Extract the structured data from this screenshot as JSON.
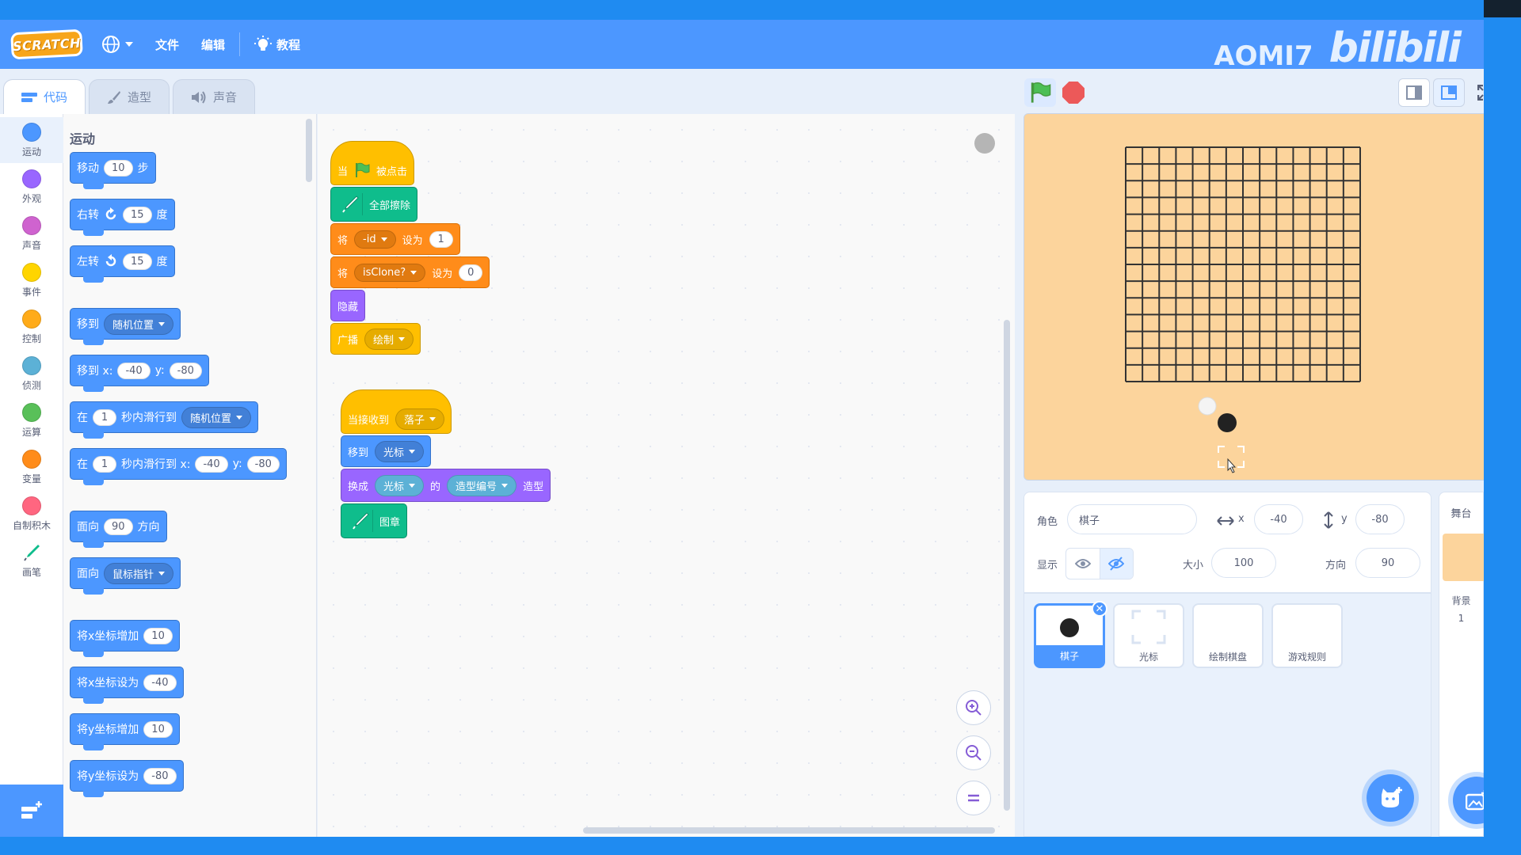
{
  "menubar": {
    "logo_text": "SCRATCH",
    "file": "文件",
    "edit": "编辑",
    "tutorials": "教程",
    "watermark_name": "AOMI7",
    "watermark_brand": "bilibili"
  },
  "tabs": {
    "code": "代码",
    "costumes": "造型",
    "sounds": "声音"
  },
  "categories": [
    {
      "label": "运动",
      "color": "#4c97ff"
    },
    {
      "label": "外观",
      "color": "#9966ff"
    },
    {
      "label": "声音",
      "color": "#cf63cf"
    },
    {
      "label": "事件",
      "color": "#ffd500"
    },
    {
      "label": "控制",
      "color": "#ffab19"
    },
    {
      "label": "侦测",
      "color": "#5cb1d6"
    },
    {
      "label": "运算",
      "color": "#59c059"
    },
    {
      "label": "变量",
      "color": "#ff8c1a"
    },
    {
      "label": "自制积木",
      "color": "#ff6680"
    },
    {
      "label": "画笔",
      "color": "#0fbd8c"
    }
  ],
  "palette": {
    "title": "运动",
    "move": {
      "label": "移动",
      "steps": "10",
      "unit": "步"
    },
    "turn_right": {
      "label": "右转",
      "deg": "15",
      "unit": "度"
    },
    "turn_left": {
      "label": "左转",
      "deg": "15",
      "unit": "度"
    },
    "goto": {
      "label": "移到",
      "target": "随机位置"
    },
    "goto_xy": {
      "label": "移到 x:",
      "x": "-40",
      "ylabel": "y:",
      "y": "-80"
    },
    "glide": {
      "pre": "在",
      "secs": "1",
      "mid": "秒内滑行到",
      "target": "随机位置"
    },
    "glide_xy": {
      "pre": "在",
      "secs": "1",
      "mid": "秒内滑行到 x:",
      "x": "-40",
      "ylabel": "y:",
      "y": "-80"
    },
    "point_dir": {
      "label": "面向",
      "dir": "90",
      "unit": "方向"
    },
    "point_towards": {
      "label": "面向",
      "target": "鼠标指针"
    },
    "change_x": {
      "label": "将x坐标增加",
      "val": "10"
    },
    "set_x": {
      "label": "将x坐标设为",
      "val": "-40"
    },
    "change_y": {
      "label": "将y坐标增加",
      "val": "10"
    },
    "set_y": {
      "label": "将y坐标设为",
      "val": "-80"
    }
  },
  "script1": {
    "hat_pre": "当",
    "hat_post": "被点击",
    "clear": "全部擦除",
    "set1": {
      "pre": "将",
      "var": "-id",
      "mid": "设为",
      "val": "1"
    },
    "set2": {
      "pre": "将",
      "var": "isClone?",
      "mid": "设为",
      "val": "0"
    },
    "hide": "隐藏",
    "broadcast": {
      "label": "广播",
      "msg": "绘制"
    }
  },
  "script2": {
    "hat": {
      "label": "当接收到",
      "msg": "落子"
    },
    "goto": {
      "label": "移到",
      "target": "光标"
    },
    "switch": {
      "label": "换成",
      "obj": "光标",
      "of": "的",
      "prop": "造型编号",
      "post": "造型"
    },
    "stamp": "图章"
  },
  "sprite_info": {
    "sprite_label": "角色",
    "sprite_name": "棋子",
    "x_label": "x",
    "x": "-40",
    "y_label": "y",
    "y": "-80",
    "show_label": "显示",
    "size_label": "大小",
    "size": "100",
    "dir_label": "方向",
    "dir": "90"
  },
  "sprites": [
    {
      "name": "棋子",
      "selected": true
    },
    {
      "name": "光标",
      "selected": false
    },
    {
      "name": "绘制棋盘",
      "selected": false
    },
    {
      "name": "游戏规则",
      "selected": false
    }
  ],
  "stage_panel": {
    "title": "舞台",
    "backdrop_label": "背景",
    "backdrop_count": "1"
  },
  "colors": {
    "stage_bg": "#fcd49c",
    "accent": "#4c97ff",
    "board_line": "#333333"
  }
}
